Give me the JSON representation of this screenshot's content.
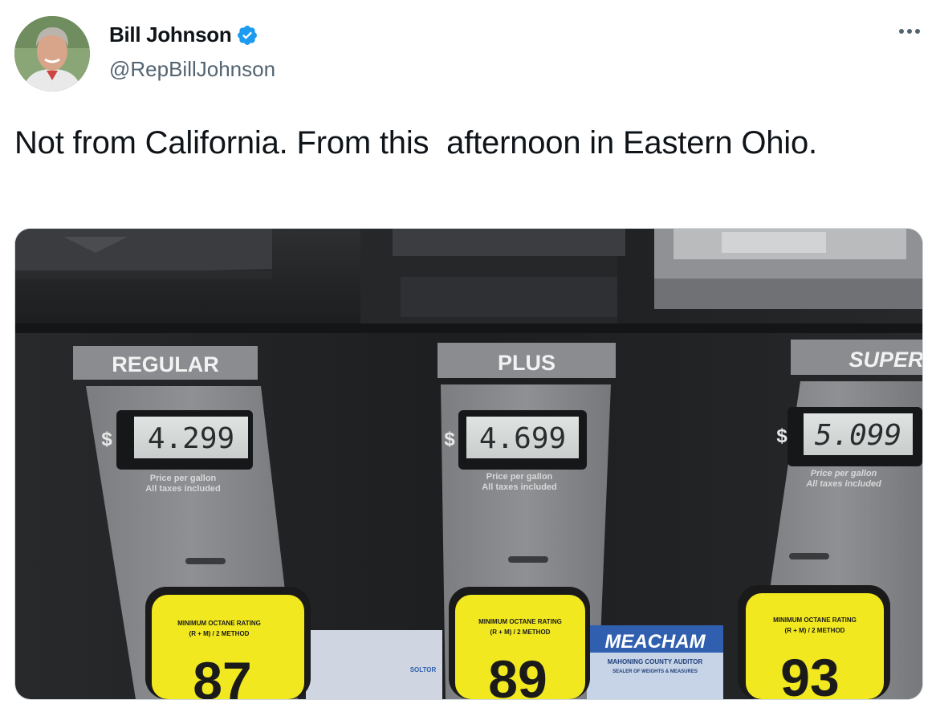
{
  "author": {
    "name": "Bill Johnson",
    "handle": "@RepBillJohnson",
    "verified": true,
    "verified_icon": "verified-badge-icon",
    "avatar_icon": "avatar"
  },
  "menu": {
    "icon": "more-horizontal-icon"
  },
  "tweet": {
    "text": "Not from California. From this  afternoon in Eastern Ohio."
  },
  "photo": {
    "pumps": [
      {
        "grade": "REGULAR",
        "price": "4.299",
        "octane": "87"
      },
      {
        "grade": "PLUS",
        "price": "4.699",
        "octane": "89"
      },
      {
        "grade": "SUPER",
        "price": "5.099",
        "octane": "93"
      }
    ],
    "price_caption_1": "Price per gallon",
    "price_caption_2": "All taxes included",
    "octane_label_1": "MINIMUM OCTANE RATING",
    "octane_label_2": "(R + M) / 2 METHOD",
    "currency": "$",
    "sticker_text": "MEACHAM",
    "sticker_sub": "MAHONING COUNTY AUDITOR",
    "sticker_sub2": "SEALER OF WEIGHTS & MEASURES",
    "sticker_left": "SOLTOR"
  },
  "colors": {
    "verified_blue": "#1d9bf0",
    "text_primary": "#0f1419",
    "text_secondary": "#536471",
    "octane_yellow": "#f1e820"
  }
}
